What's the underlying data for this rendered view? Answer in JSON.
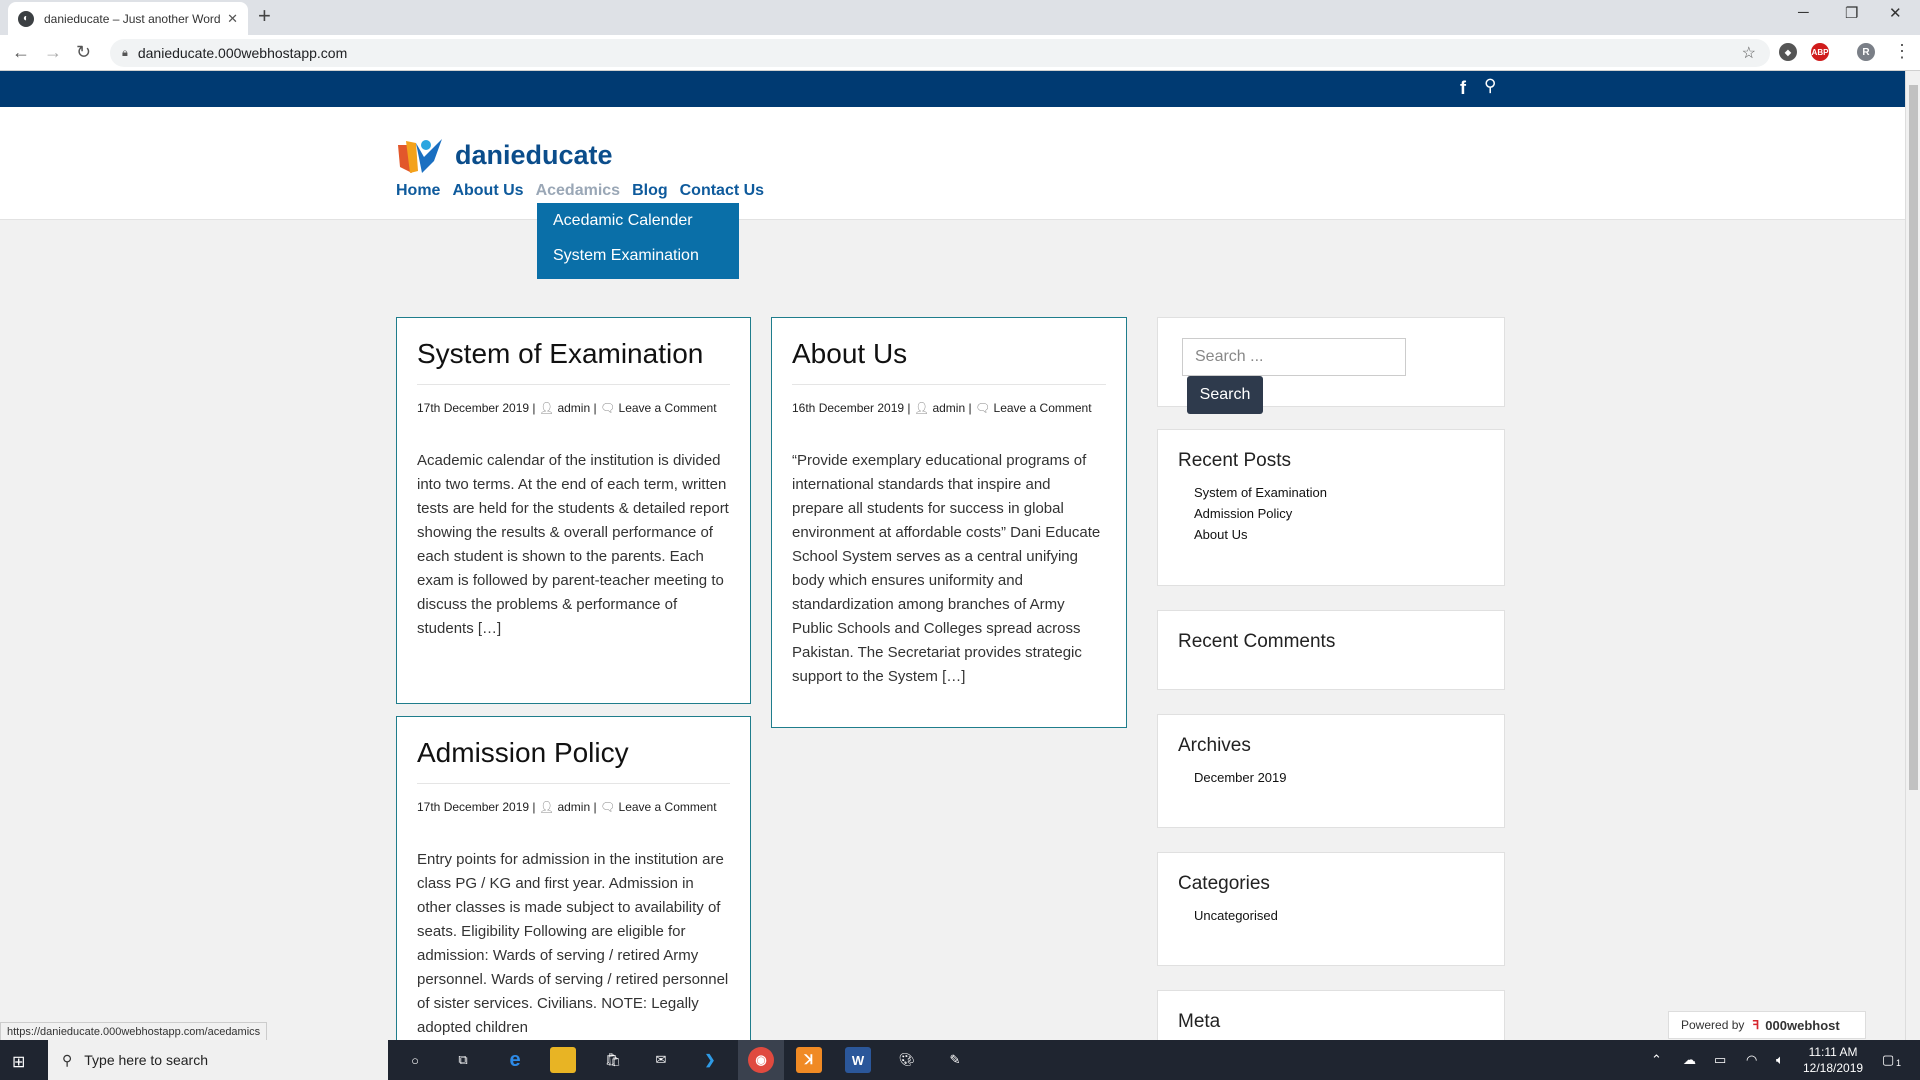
{
  "browser": {
    "tab_title": "danieducate – Just another Word",
    "url": "danieducate.000webhostapp.com",
    "status_url": "https://danieducate.000webhostapp.com/acedamics",
    "profile_initial": "R"
  },
  "site": {
    "name": "danieducate",
    "menu": [
      "Home",
      "About Us",
      "Acedamics",
      "Blog",
      "Contact Us"
    ],
    "dropdown": [
      "Acedamic Calender",
      "System Examination"
    ]
  },
  "posts": [
    {
      "title": "System of Examination",
      "date": "17th December 2019",
      "author": "admin",
      "comments": "Leave a Comment",
      "excerpt": "Academic calendar of the institution is divided into two terms. At the end of each term, written tests are held for the students & detailed report showing the results & overall performance of each student is shown to the parents. Each exam is followed by parent-teacher meeting to discuss the problems & performance of students […]"
    },
    {
      "title": "About Us",
      "date": "16th December 2019",
      "author": "admin",
      "comments": "Leave a Comment",
      "excerpt": "“Provide exemplary educational programs of international standards that inspire and prepare all students for success in global environment at affordable costs” Dani Educate School System serves as a central unifying body which ensures uniformity and standardization among branches of Army Public Schools and Colleges spread across Pakistan. The Secretariat provides strategic support to the System […]"
    },
    {
      "title": "Admission Policy",
      "date": "17th December 2019",
      "author": "admin",
      "comments": "Leave a Comment",
      "excerpt": "Entry points for admission in the institution are class PG / KG and first year. Admission in other classes is made subject to availability of seats. Eligibility Following are eligible for admission: Wards of serving / retired Army personnel. Wards of serving / retired personnel of sister services. Civilians. NOTE: Legally adopted children"
    }
  ],
  "sidebar": {
    "search_placeholder": "Search ...",
    "search_button": "Search",
    "recent_posts_title": "Recent Posts",
    "recent_posts": [
      "System of Examination",
      "Admission Policy",
      "About Us"
    ],
    "recent_comments_title": "Recent Comments",
    "archives_title": "Archives",
    "archives": [
      "December 2019"
    ],
    "categories_title": "Categories",
    "categories": [
      "Uncategorised"
    ],
    "meta_title": "Meta"
  },
  "powered": {
    "label": "Powered by",
    "brand": "000webhost"
  },
  "taskbar": {
    "search_placeholder": "Type here to search",
    "time": "11:11 AM",
    "date": "12/18/2019",
    "notification_count": "1"
  },
  "colors": {
    "topbar": "#003a72",
    "dropdown": "#0a6fa8",
    "link": "#0e5a9c",
    "post_border": "#1f7d8c"
  }
}
